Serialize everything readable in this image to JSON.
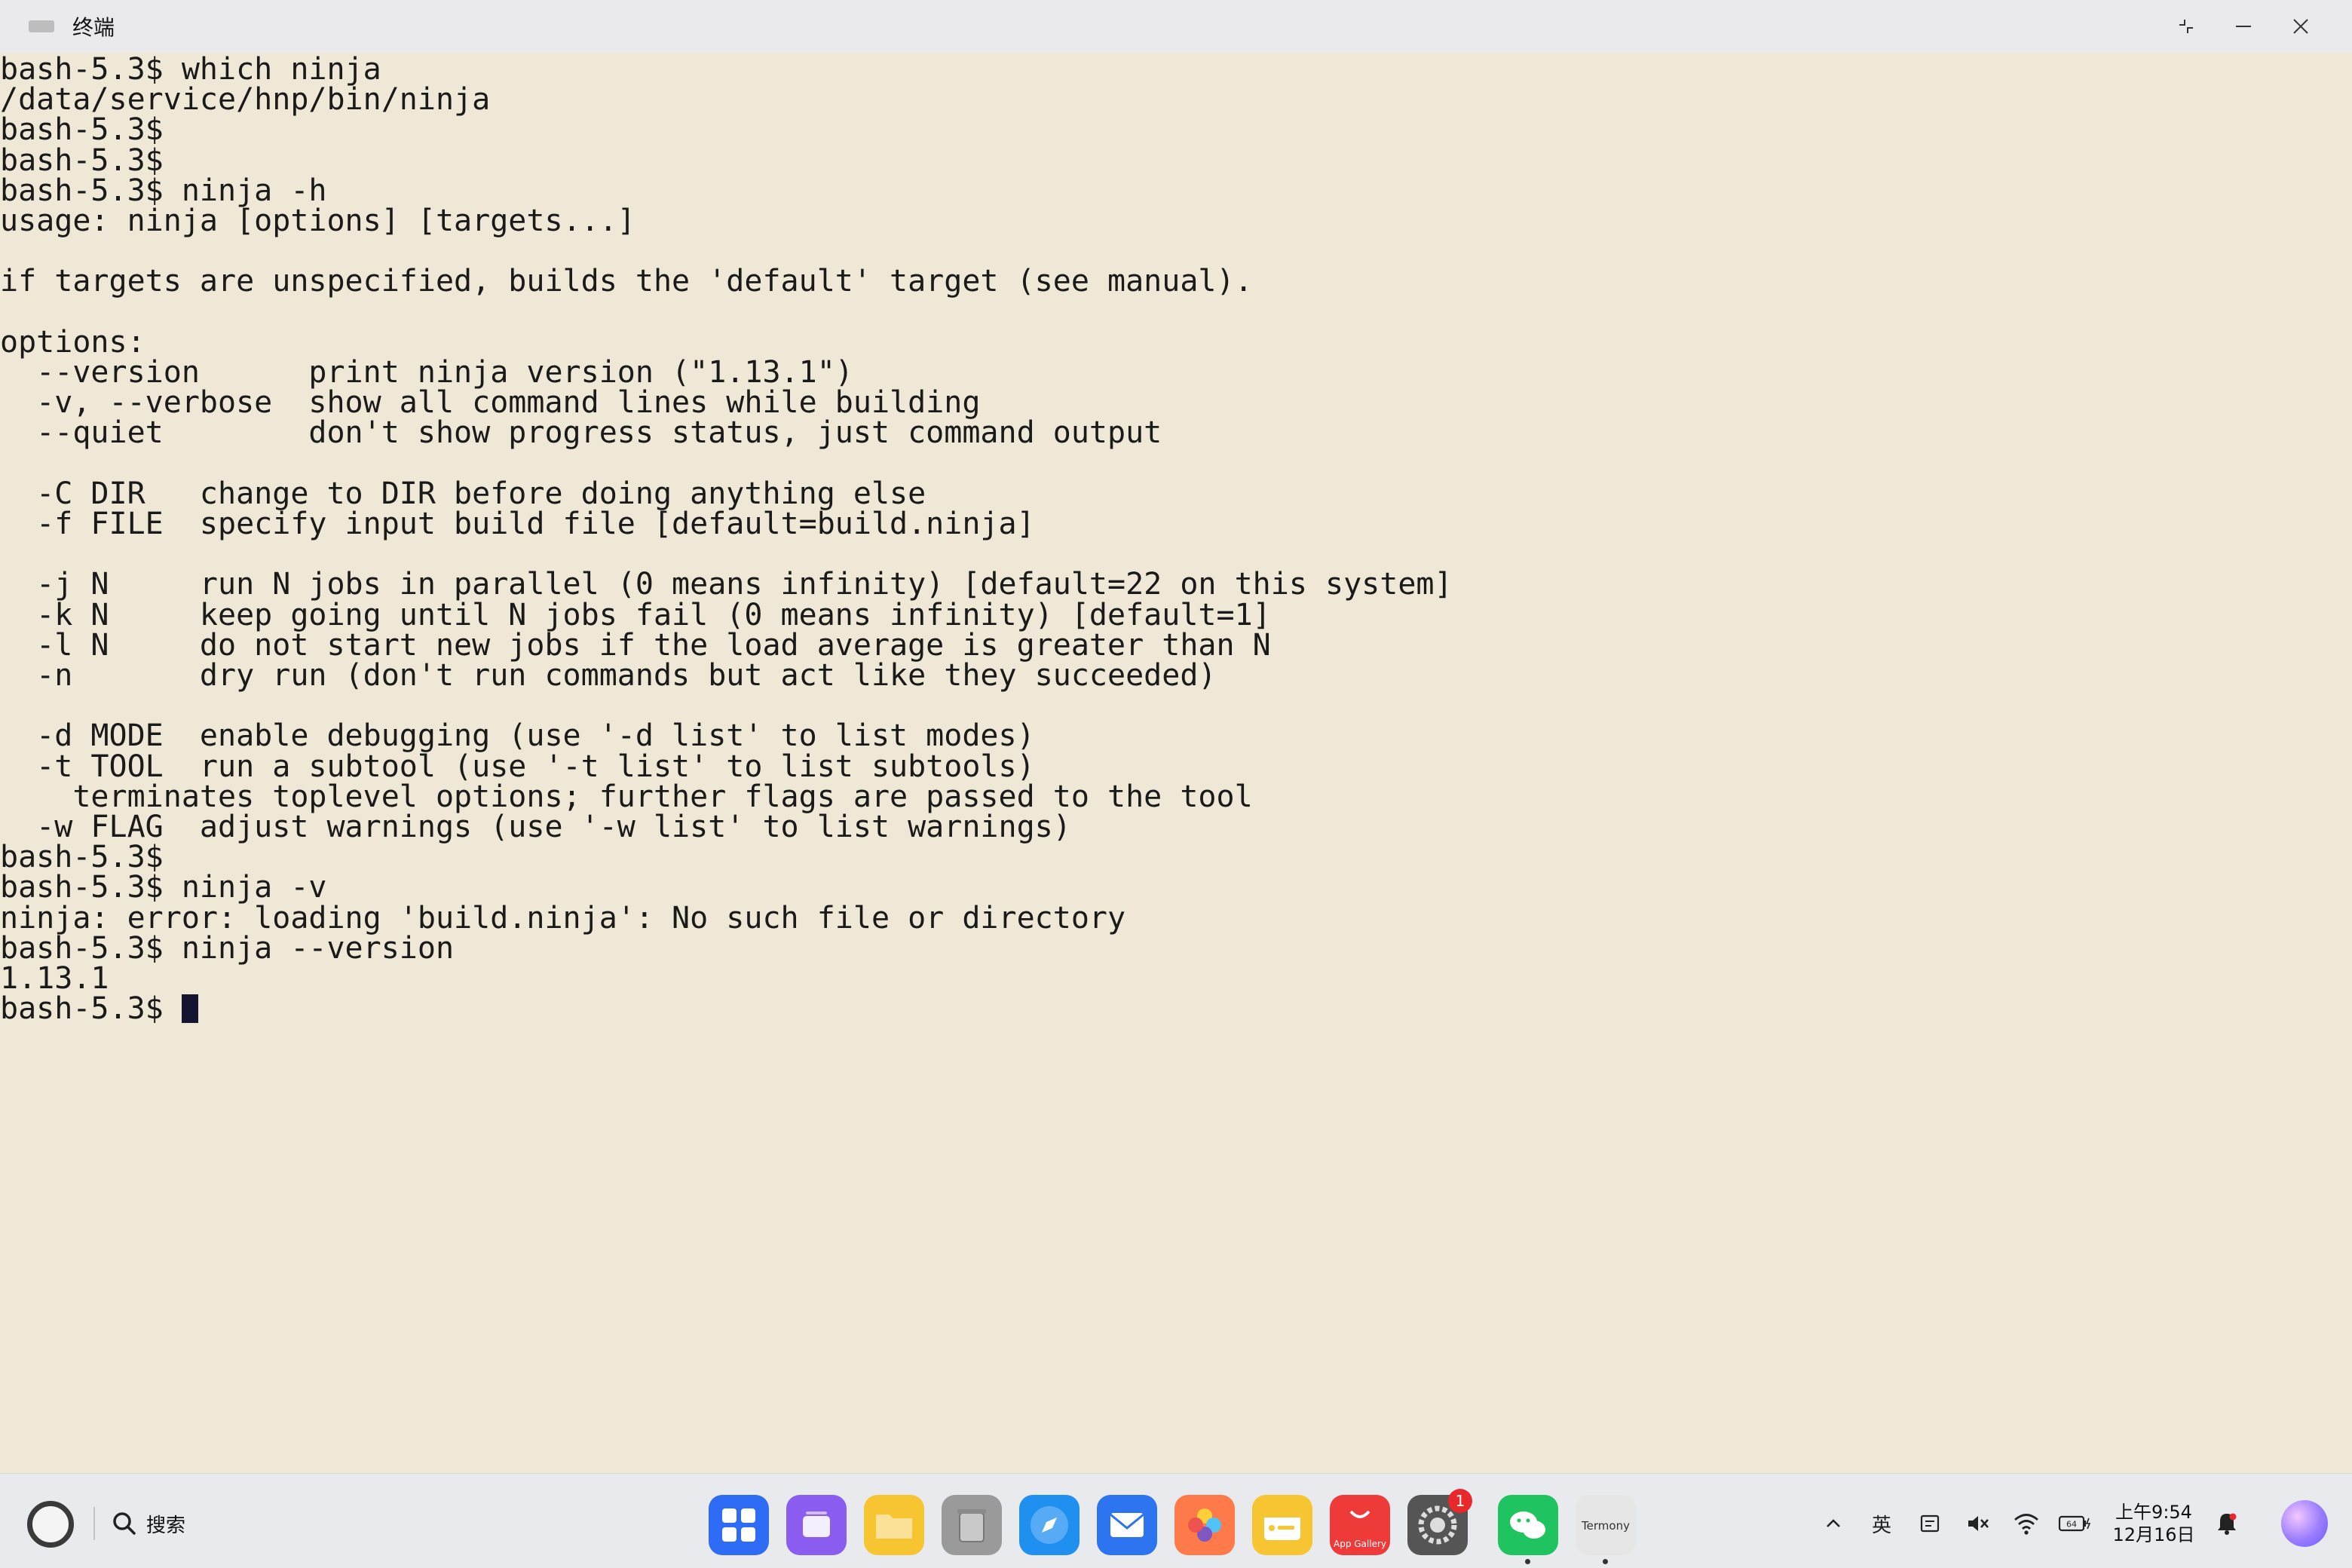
{
  "window": {
    "app_icon_text": "Termony",
    "title": "终端",
    "controls": [
      "restore-icon",
      "minimize-icon",
      "close-icon"
    ]
  },
  "terminal": {
    "lines": [
      "bash-5.3$ which ninja",
      "/data/service/hnp/bin/ninja",
      "bash-5.3$",
      "bash-5.3$",
      "bash-5.3$ ninja -h",
      "usage: ninja [options] [targets...]",
      "",
      "if targets are unspecified, builds the 'default' target (see manual).",
      "",
      "options:",
      "  --version      print ninja version (\"1.13.1\")",
      "  -v, --verbose  show all command lines while building",
      "  --quiet        don't show progress status, just command output",
      "",
      "  -C DIR   change to DIR before doing anything else",
      "  -f FILE  specify input build file [default=build.ninja]",
      "",
      "  -j N     run N jobs in parallel (0 means infinity) [default=22 on this system]",
      "  -k N     keep going until N jobs fail (0 means infinity) [default=1]",
      "  -l N     do not start new jobs if the load average is greater than N",
      "  -n       dry run (don't run commands but act like they succeeded)",
      "",
      "  -d MODE  enable debugging (use '-d list' to list modes)",
      "  -t TOOL  run a subtool (use '-t list' to list subtools)",
      "    terminates toplevel options; further flags are passed to the tool",
      "  -w FLAG  adjust warnings (use '-w list' to list warnings)",
      "bash-5.3$",
      "bash-5.3$ ninja -v",
      "ninja: error: loading 'build.ninja': No such file or directory",
      "bash-5.3$ ninja --version",
      "1.13.1",
      "bash-5.3$ "
    ]
  },
  "taskbar": {
    "search_label": "搜索",
    "apps": [
      {
        "name": "app-launcher-icon",
        "color": "#2f6cf5"
      },
      {
        "name": "multitask-icon",
        "color": "#8b5cf0"
      },
      {
        "name": "files-icon",
        "color": "#f7c531"
      },
      {
        "name": "trash-icon",
        "color": "#9a9a9a"
      },
      {
        "name": "browser-icon",
        "color": "#1f8ff0"
      },
      {
        "name": "mail-icon",
        "color": "#2c74f0"
      },
      {
        "name": "gallery-icon",
        "color": "#ff7a4a"
      },
      {
        "name": "notes-icon",
        "color": "#f7c531"
      },
      {
        "name": "app-gallery-icon",
        "color": "#ef3a3a",
        "label": "App Gallery"
      },
      {
        "name": "settings-icon",
        "color": "#555555",
        "badge": "1"
      },
      {
        "name": "wechat-icon",
        "color": "#1fc35f"
      },
      {
        "name": "termony-icon",
        "color": "#e6e6e6",
        "label": "Termony"
      }
    ],
    "ime_label": "英",
    "battery_label": "64",
    "clock_time": "上午9:54",
    "clock_date": "12月16日"
  }
}
